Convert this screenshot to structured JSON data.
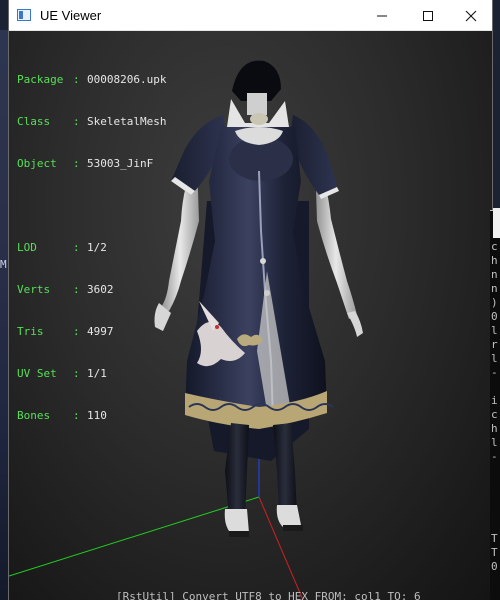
{
  "window": {
    "title": "UE Viewer",
    "buttons": {
      "minimize": "—",
      "maximize": "☐",
      "close": "✕"
    }
  },
  "info": {
    "package": {
      "key": "Package",
      "sep": ":",
      "value": "00008206.upk"
    },
    "class": {
      "key": "Class",
      "sep": ":",
      "value": "SkeletalMesh"
    },
    "object": {
      "key": "Object",
      "sep": ":",
      "value": "53003_JinF"
    },
    "lod": {
      "key": "LOD",
      "sep": ":",
      "value": "1/2"
    },
    "verts": {
      "key": "Verts",
      "sep": ":",
      "value": "3602"
    },
    "tris": {
      "key": "Tris",
      "sep": ":",
      "value": "4997"
    },
    "uvset": {
      "key": "UV Set",
      "sep": ":",
      "value": "1/1"
    },
    "bones": {
      "key": "Bones",
      "sep": ":",
      "value": "110"
    }
  },
  "desktop": {
    "left_char": "M"
  },
  "console": {
    "lines": [
      "c",
      "h",
      "n",
      "n",
      ")",
      "0",
      "l",
      "r",
      "l",
      "-",
      "i",
      "c",
      "h",
      "l",
      "-",
      "T",
      "T",
      "0"
    ]
  },
  "status_text": "[RstUtil] Convert UTF8 to HEX  FROM: col1  TO: 6",
  "colors": {
    "info_label": "#56e056",
    "info_value": "#e6e6e6",
    "axis_x": "#d02020",
    "axis_y": "#20d020",
    "axis_z": "#2040e0"
  }
}
